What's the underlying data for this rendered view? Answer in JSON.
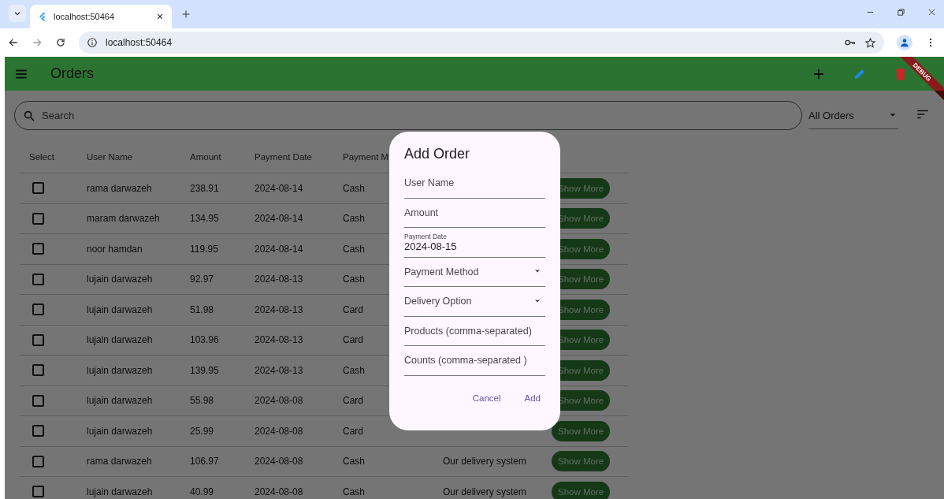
{
  "browser": {
    "tab_title": "localhost:50464",
    "address": "localhost:50464"
  },
  "app_bar": {
    "title": "Orders",
    "debug_banner": "DEBUG"
  },
  "search": {
    "placeholder": "Search"
  },
  "filter": {
    "value": "All Orders"
  },
  "table": {
    "columns": [
      "Select",
      "User Name",
      "Amount",
      "Payment Date",
      "Payment M"
    ],
    "rows": [
      {
        "checked": false,
        "user": "rama darwazeh",
        "amount": "238.91",
        "date": "2024-08-14",
        "method": "Cash",
        "action": "Show More"
      },
      {
        "checked": false,
        "user": "maram darwazeh",
        "amount": "134.95",
        "date": "2024-08-14",
        "method": "Cash",
        "action": "Show More"
      },
      {
        "checked": false,
        "user": "noor hamdan",
        "amount": "119.95",
        "date": "2024-08-14",
        "method": "Cash",
        "action": "Show More"
      },
      {
        "checked": false,
        "user": "lujain darwazeh",
        "amount": "92.97",
        "date": "2024-08-13",
        "method": "Cash",
        "action": "Show More"
      },
      {
        "checked": false,
        "user": "lujain darwazeh",
        "amount": "51.98",
        "date": "2024-08-13",
        "method": "Card",
        "action": "Show More"
      },
      {
        "checked": false,
        "user": "lujain darwazeh",
        "amount": "103.96",
        "date": "2024-08-13",
        "method": "Card",
        "action": "Show More"
      },
      {
        "checked": false,
        "user": "lujain darwazeh",
        "amount": "139.95",
        "date": "2024-08-13",
        "method": "Cash",
        "action": "Show More"
      },
      {
        "checked": false,
        "user": "lujain darwazeh",
        "amount": "55.98",
        "date": "2024-08-08",
        "method": "Card",
        "action": "Show More"
      },
      {
        "checked": false,
        "user": "lujain darwazeh",
        "amount": "25.99",
        "date": "2024-08-08",
        "method": "Card",
        "action": "Show More"
      },
      {
        "checked": false,
        "user": "rama darwazeh",
        "amount": "106.97",
        "date": "2024-08-08",
        "method": "Cash",
        "delivery": "Our delivery system",
        "action": "Show More"
      },
      {
        "checked": false,
        "user": "lujain darwazeh",
        "amount": "40.99",
        "date": "2024-08-08",
        "method": "Cash",
        "delivery": "Our delivery system",
        "action": "Show More"
      }
    ]
  },
  "dialog": {
    "title": "Add Order",
    "fields": [
      {
        "kind": "text",
        "label": "User Name"
      },
      {
        "kind": "text",
        "label": "Amount"
      },
      {
        "kind": "text",
        "label": "Payment Date",
        "value": "2024-08-15"
      },
      {
        "kind": "dropdown",
        "label": "Payment Method"
      },
      {
        "kind": "dropdown",
        "label": "Delivery Option"
      },
      {
        "kind": "text",
        "label": "Products (comma-separated)"
      },
      {
        "kind": "text",
        "label": "Counts (comma-separated )"
      }
    ],
    "buttons": [
      "Cancel",
      "Add"
    ]
  }
}
